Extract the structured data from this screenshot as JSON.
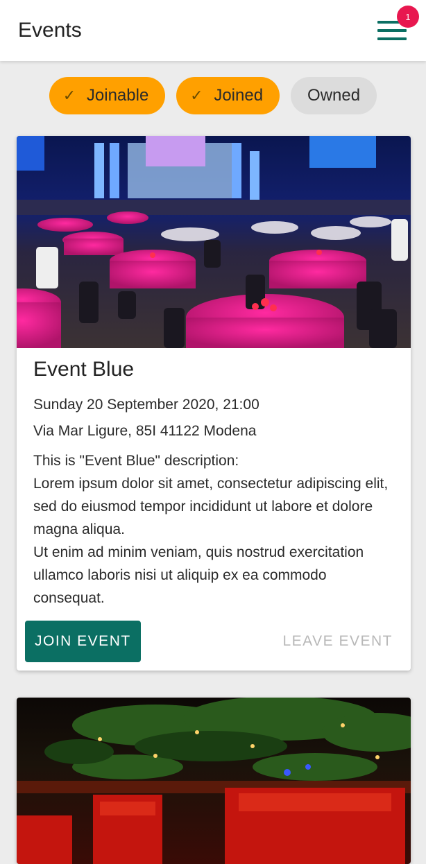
{
  "appbar": {
    "title": "Events",
    "menu_icon": "hamburger-menu-icon",
    "notification_count": "1"
  },
  "filters": [
    {
      "label": "Joinable",
      "selected": true
    },
    {
      "label": "Joined",
      "selected": true
    },
    {
      "label": "Owned",
      "selected": false
    }
  ],
  "colors": {
    "primary": "#0b6f63",
    "accent_chip": "#ffa000",
    "badge": "#e8174f"
  },
  "events": [
    {
      "image_desc": "banquet-hall-photo",
      "title": "Event Blue",
      "date": "Sunday 20 September 2020, 21:00",
      "place": "Via Mar Ligure, 85I 41122 Modena",
      "description": "This is \"Event Blue\" description:\nLorem ipsum dolor sit amet, consectetur adipiscing elit, sed do eiusmod tempor incididunt ut labore et dolore magna aliqua.\nUt enim ad minim veniam, quis nostrud exercitation ullamco laboris nisi ut aliquip ex ea commodo consequat.",
      "join_label": "JOIN EVENT",
      "leave_label": "LEAVE EVENT"
    },
    {
      "image_desc": "red-lounge-photo"
    }
  ]
}
